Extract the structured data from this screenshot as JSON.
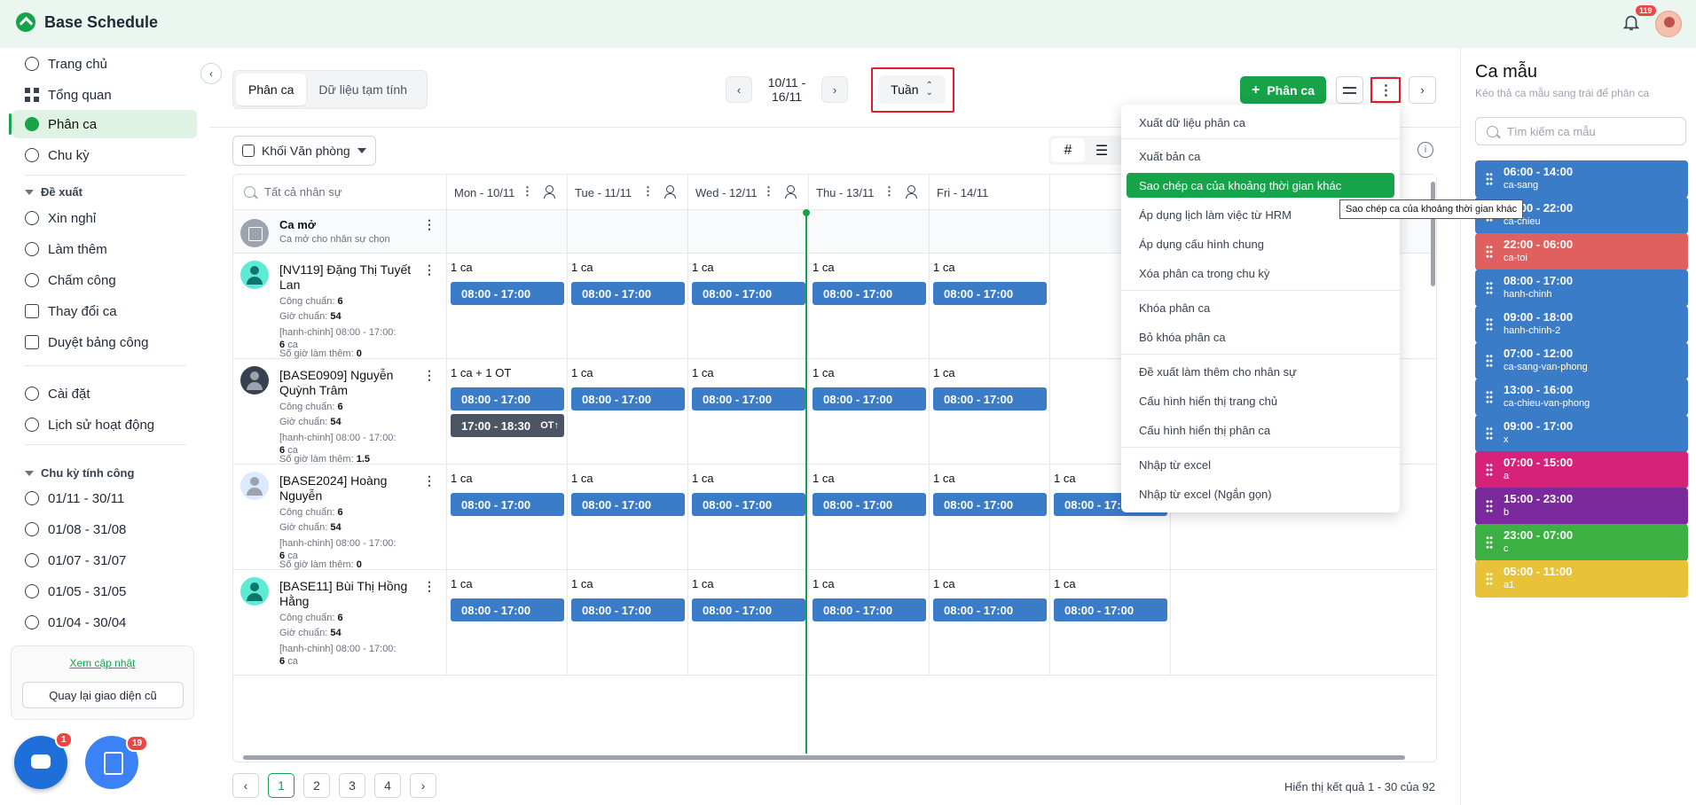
{
  "app": {
    "title": "Base Schedule",
    "notif_count": "119"
  },
  "sidebar": {
    "items": [
      {
        "label": "Trang chủ",
        "icon": "clock-icon"
      },
      {
        "label": "Tổng quan",
        "icon": "grid-icon"
      },
      {
        "label": "Phân ca",
        "icon": "shift-icon",
        "active": true
      },
      {
        "label": "Chu kỳ",
        "icon": "cycle-icon"
      }
    ],
    "proposal_header": "Đề xuất",
    "proposal_items": [
      {
        "label": "Xin nghỉ"
      },
      {
        "label": "Làm thêm"
      },
      {
        "label": "Chấm công"
      },
      {
        "label": "Thay đổi ca"
      },
      {
        "label": "Duyệt bảng công"
      }
    ],
    "settings_items": [
      {
        "label": "Cài đặt"
      },
      {
        "label": "Lịch sử hoạt động"
      }
    ],
    "cycle_header": "Chu kỳ tính công",
    "cycles": [
      "01/11 - 30/11",
      "01/08 - 31/08",
      "01/07 - 31/07",
      "01/05 - 31/05",
      "01/04 - 30/04"
    ],
    "update_link": "Xem cập nhật",
    "old_ui_button": "Quay lại giao diện cũ",
    "chat_badge": "1",
    "task_badge": "19"
  },
  "toolbar": {
    "tabs": [
      "Phân ca",
      "Dữ liệu tạm tính"
    ],
    "date_range": "10/11 - 16/11",
    "view_mode": "Tuần",
    "add_shift": "Phân ca",
    "department": "Khối Văn phòng"
  },
  "grid": {
    "search_placeholder": "Tất cả nhân sự",
    "days": [
      "Mon - 10/11",
      "Tue - 11/11",
      "Wed - 12/11",
      "Thu - 13/11",
      "Fri - 14/11"
    ],
    "open_shift": {
      "title": "Ca mở",
      "sub": "Ca mở cho nhân sự chọn"
    },
    "labels": {
      "cong": "Công chuẩn:",
      "gio": "Giờ chuẩn:",
      "ot": "Số giờ làm thêm:",
      "ca": "ca"
    },
    "employees": [
      {
        "name": "[NV119] Đặng Thị Tuyết Lan",
        "cong": "6",
        "gio": "54",
        "shift_info": "[hanh-chinh] 08:00 - 17:00:",
        "shift_count": "6",
        "ot": "0",
        "days": [
          {
            "h": "1 ca",
            "s": "08:00 - 17:00"
          },
          {
            "h": "1 ca",
            "s": "08:00 - 17:00"
          },
          {
            "h": "1 ca",
            "s": "08:00 - 17:00"
          },
          {
            "h": "1 ca",
            "s": "08:00 - 17:00"
          },
          {
            "h": "1 ca",
            "s": "08:00 - 17:00"
          }
        ]
      },
      {
        "name": "[BASE0909] Nguyễn Quỳnh Trâm",
        "cong": "6",
        "gio": "54",
        "shift_info": "[hanh-chinh] 08:00 - 17:00:",
        "shift_count": "6",
        "ot": "1.5",
        "days": [
          {
            "h": "1 ca + 1 OT",
            "s": "08:00 - 17:00",
            "ot": "17:00 - 18:30",
            "ot_tag": "OT↑"
          },
          {
            "h": "1 ca",
            "s": "08:00 - 17:00"
          },
          {
            "h": "1 ca",
            "s": "08:00 - 17:00"
          },
          {
            "h": "1 ca",
            "s": "08:00 - 17:00"
          },
          {
            "h": "1 ca",
            "s": "08:00 - 17:00"
          }
        ]
      },
      {
        "name": "[BASE2024] Hoàng Nguyễn",
        "cong": "6",
        "gio": "54",
        "shift_info": "[hanh-chinh] 08:00 - 17:00:",
        "shift_count": "6",
        "ot": "0",
        "days": [
          {
            "h": "1 ca",
            "s": "08:00 - 17:00"
          },
          {
            "h": "1 ca",
            "s": "08:00 - 17:00"
          },
          {
            "h": "1 ca",
            "s": "08:00 - 17:00"
          },
          {
            "h": "1 ca",
            "s": "08:00 - 17:00"
          },
          {
            "h": "1 ca",
            "s": "08:00 - 17:00"
          },
          {
            "h": "1 ca",
            "s": "08:00 - 17:00"
          }
        ]
      },
      {
        "name": "[BASE11] Bùi Thị Hồng Hằng",
        "cong": "6",
        "gio": "54",
        "shift_info": "[hanh-chinh] 08:00 - 17:00:",
        "shift_count": "6",
        "days": [
          {
            "h": "1 ca",
            "s": "08:00 - 17:00"
          },
          {
            "h": "1 ca",
            "s": "08:00 - 17:00"
          },
          {
            "h": "1 ca",
            "s": "08:00 - 17:00"
          },
          {
            "h": "1 ca",
            "s": "08:00 - 17:00"
          },
          {
            "h": "1 ca",
            "s": "08:00 - 17:00"
          },
          {
            "h": "1 ca",
            "s": "08:00 - 17:00"
          }
        ]
      }
    ]
  },
  "pagination": {
    "pages": [
      "1",
      "2",
      "3",
      "4"
    ],
    "current": "1",
    "results": "Hiển thị kết quả 1 - 30 của 92"
  },
  "menu": {
    "items": [
      "Xuất dữ liệu phân ca",
      "Xuất bản ca",
      "Sao chép ca của khoảng thời gian khác",
      "Áp dụng lịch làm việc từ HRM",
      "Áp dụng cấu hình chung",
      "Xóa phân ca trong chu kỳ",
      "Khóa phân ca",
      "Bỏ khóa phân ca",
      "Đề xuất làm thêm cho nhân sự",
      "Cấu hình hiển thị trang chủ",
      "Cấu hình hiển thị phân ca",
      "Nhập từ excel",
      "Nhập từ excel (Ngắn gọn)"
    ],
    "highlighted": "Sao chép ca của khoảng thời gian khác",
    "tooltip": "Sao chép ca của khoảng thời gian khác"
  },
  "templates": {
    "title": "Ca mẫu",
    "subtitle": "Kéo thả ca mẫu sang trái để phân ca",
    "search_placeholder": "Tìm kiếm ca mẫu",
    "items": [
      {
        "time": "06:00 - 14:00",
        "code": "ca-sang",
        "color": "#3b7cc9"
      },
      {
        "time": "14:00 - 22:00",
        "code": "ca-chieu",
        "color": "#3b7cc9"
      },
      {
        "time": "22:00 - 06:00",
        "code": "ca-toi",
        "color": "#e06060"
      },
      {
        "time": "08:00 - 17:00",
        "code": "hanh-chinh",
        "color": "#3b7cc9"
      },
      {
        "time": "09:00 - 18:00",
        "code": "hanh-chinh-2",
        "color": "#3b7cc9"
      },
      {
        "time": "07:00 - 12:00",
        "code": "ca-sang-van-phong",
        "color": "#3b7cc9"
      },
      {
        "time": "13:00 - 16:00",
        "code": "ca-chieu-van-phong",
        "color": "#3b7cc9"
      },
      {
        "time": "09:00 - 17:00",
        "code": "x",
        "color": "#3b7cc9"
      },
      {
        "time": "07:00 - 15:00",
        "code": "a",
        "color": "#d6227a"
      },
      {
        "time": "15:00 - 23:00",
        "code": "b",
        "color": "#7b2a9e"
      },
      {
        "time": "23:00 - 07:00",
        "code": "c",
        "color": "#3cb043"
      },
      {
        "time": "05:00 - 11:00",
        "code": "a1",
        "color": "#e8c339"
      }
    ]
  }
}
